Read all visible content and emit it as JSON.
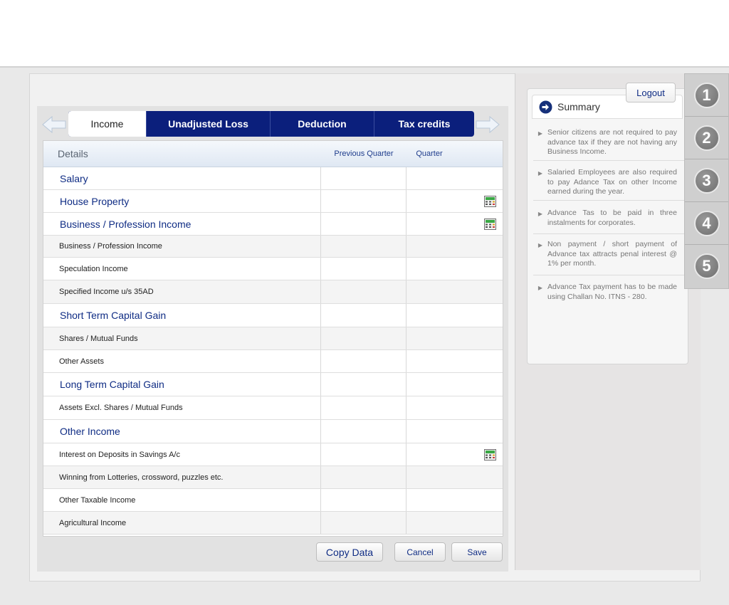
{
  "tabs": [
    {
      "label": "Income"
    },
    {
      "label": "Unadjusted Loss"
    },
    {
      "label": "Deduction"
    },
    {
      "label": "Tax credits"
    }
  ],
  "table": {
    "headers": {
      "details": "Details",
      "previous": "Previous Quarter",
      "quarter": "Quarter"
    },
    "rows": [
      {
        "label": "Salary",
        "type": "section",
        "calc": false
      },
      {
        "label": "House Property",
        "type": "section",
        "calc": true
      },
      {
        "label": "Business / Profession Income",
        "type": "section",
        "calc": true
      },
      {
        "label": "Business / Profession Income",
        "type": "item",
        "calc": false
      },
      {
        "label": "Speculation Income",
        "type": "item",
        "calc": false
      },
      {
        "label": "Specified Income u/s 35AD",
        "type": "item",
        "calc": false
      },
      {
        "label": "Short Term Capital Gain",
        "type": "section",
        "calc": false
      },
      {
        "label": "Shares / Mutual Funds",
        "type": "item",
        "calc": false
      },
      {
        "label": "Other Assets",
        "type": "item",
        "calc": false
      },
      {
        "label": "Long Term Capital Gain",
        "type": "section",
        "calc": false
      },
      {
        "label": "Assets Excl. Shares / Mutual Funds",
        "type": "item",
        "calc": false
      },
      {
        "label": "Other Income",
        "type": "section",
        "calc": false
      },
      {
        "label": "Interest on Deposits in Savings A/c",
        "type": "item",
        "calc": true
      },
      {
        "label": "Winning from Lotteries, crossword, puzzles etc.",
        "type": "item",
        "calc": false
      },
      {
        "label": "Other Taxable Income",
        "type": "item",
        "calc": false
      },
      {
        "label": "Agricultural Income",
        "type": "item",
        "calc": false
      }
    ]
  },
  "buttons": {
    "copy": "Copy Data",
    "cancel": "Cancel",
    "save": "Save"
  },
  "summary": {
    "title": "Summary",
    "tips": [
      "Senior citizens are not required to pay advance tax if they are not having any Business Income.",
      "Salaried Employees are also required to pay Adance Tax on other Income earned during the year.",
      "Advance Tas to be paid in three instalments for corporates.",
      "Non payment / short payment of Advance tax attracts penal interest @ 1% per month.",
      "Advance Tax payment has to be made using Challan No. ITNS - 280."
    ]
  },
  "logout": "Logout",
  "steps": [
    "1",
    "2",
    "3",
    "4",
    "5"
  ],
  "colors": {
    "navy": "#0b1f7c",
    "link": "#0f2c84"
  }
}
